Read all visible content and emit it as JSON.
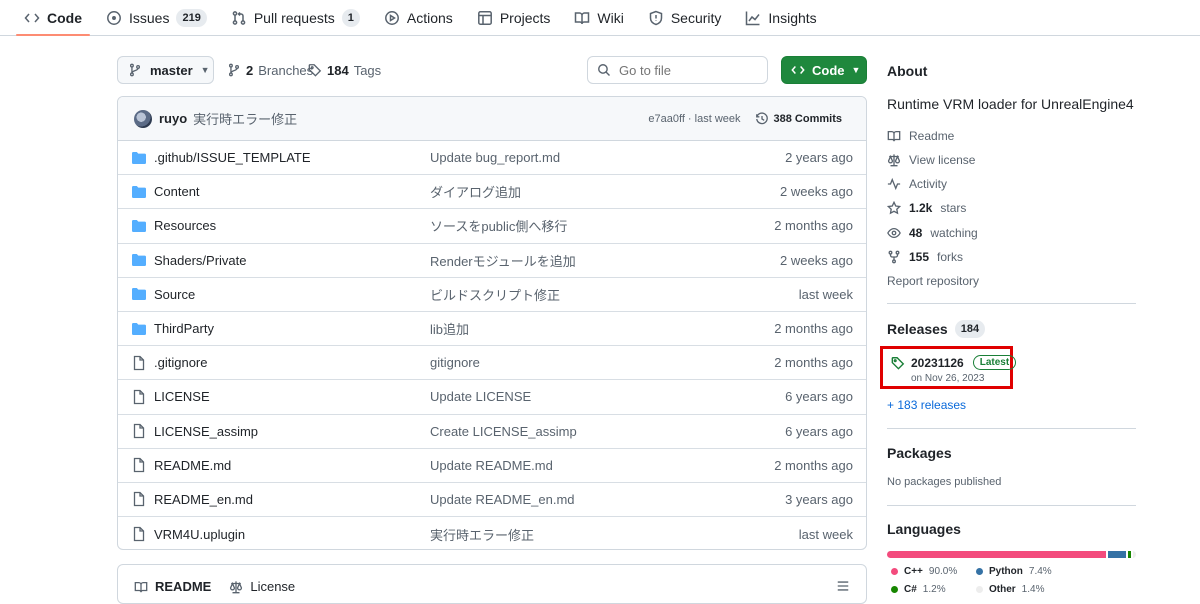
{
  "nav": {
    "tabs": [
      {
        "label": "Code",
        "icon": "code-icon",
        "active": true
      },
      {
        "label": "Issues",
        "icon": "issue-icon",
        "count": "219"
      },
      {
        "label": "Pull requests",
        "icon": "pull-request-icon",
        "count": "1"
      },
      {
        "label": "Actions",
        "icon": "play-icon"
      },
      {
        "label": "Projects",
        "icon": "table-icon"
      },
      {
        "label": "Wiki",
        "icon": "book-icon"
      },
      {
        "label": "Security",
        "icon": "shield-icon"
      },
      {
        "label": "Insights",
        "icon": "graph-icon"
      }
    ]
  },
  "toolbar": {
    "branch": "master",
    "branches_count": "2",
    "branches_label": "Branches",
    "tags_count": "184",
    "tags_label": "Tags",
    "goto_placeholder": "Go to file",
    "code_label": "Code"
  },
  "commit": {
    "author": "ruyo",
    "message": "実行時エラー修正",
    "sha_time": "e7aa0ff · last week",
    "commits": "388 Commits"
  },
  "files": [
    {
      "type": "folder",
      "name": ".github/ISSUE_TEMPLATE",
      "message": "Update bug_report.md",
      "date": "2 years ago"
    },
    {
      "type": "folder",
      "name": "Content",
      "message": "ダイアログ追加",
      "date": "2 weeks ago"
    },
    {
      "type": "folder",
      "name": "Resources",
      "message": "ソースをpublic側へ移行",
      "date": "2 months ago"
    },
    {
      "type": "folder",
      "name": "Shaders/Private",
      "message": "Renderモジュールを追加",
      "date": "2 weeks ago"
    },
    {
      "type": "folder",
      "name": "Source",
      "message": "ビルドスクリプト修正",
      "date": "last week"
    },
    {
      "type": "folder",
      "name": "ThirdParty",
      "message": "lib追加",
      "date": "2 months ago"
    },
    {
      "type": "file",
      "name": ".gitignore",
      "message": "gitignore",
      "date": "2 months ago"
    },
    {
      "type": "file",
      "name": "LICENSE",
      "message": "Update LICENSE",
      "date": "6 years ago"
    },
    {
      "type": "file",
      "name": "LICENSE_assimp",
      "message": "Create LICENSE_assimp",
      "date": "6 years ago"
    },
    {
      "type": "file",
      "name": "README.md",
      "message": "Update README.md",
      "date": "2 months ago"
    },
    {
      "type": "file",
      "name": "README_en.md",
      "message": "Update README_en.md",
      "date": "3 years ago"
    },
    {
      "type": "file",
      "name": "VRM4U.uplugin",
      "message": "実行時エラー修正",
      "date": "last week"
    }
  ],
  "readme_tabs": {
    "readme": "README",
    "license": "License"
  },
  "about": {
    "title": "About",
    "description": "Runtime VRM loader for UnrealEngine4",
    "readme": "Readme",
    "license": "View license",
    "activity": "Activity",
    "stars": "1.2k",
    "stars_label": "stars",
    "watching": "48",
    "watching_label": "watching",
    "forks": "155",
    "forks_label": "forks",
    "report": "Report repository"
  },
  "releases": {
    "title": "Releases",
    "count": "184",
    "latest_tag": "20231126",
    "latest_badge": "Latest",
    "latest_date": "on Nov 26, 2023",
    "more": "+ 183 releases"
  },
  "packages": {
    "title": "Packages",
    "empty": "No packages published"
  },
  "languages": {
    "title": "Languages",
    "items": [
      {
        "name": "C++",
        "percent": "90.0%",
        "value": 90.0,
        "color": "#f34b7d"
      },
      {
        "name": "Python",
        "percent": "7.4%",
        "value": 7.4,
        "color": "#3572a5"
      },
      {
        "name": "C#",
        "percent": "1.2%",
        "value": 1.2,
        "color": "#178600"
      },
      {
        "name": "Other",
        "percent": "1.4%",
        "value": 1.4,
        "color": "#ededed"
      }
    ],
    "extra_segment_color": "#3d7a9e"
  },
  "colors": {
    "accent_green": "#1f883d",
    "link_blue": "#0969da",
    "active_tab_underline": "#fd8c73",
    "highlight_red": "#e00000",
    "folder_blue": "#54aeff"
  }
}
